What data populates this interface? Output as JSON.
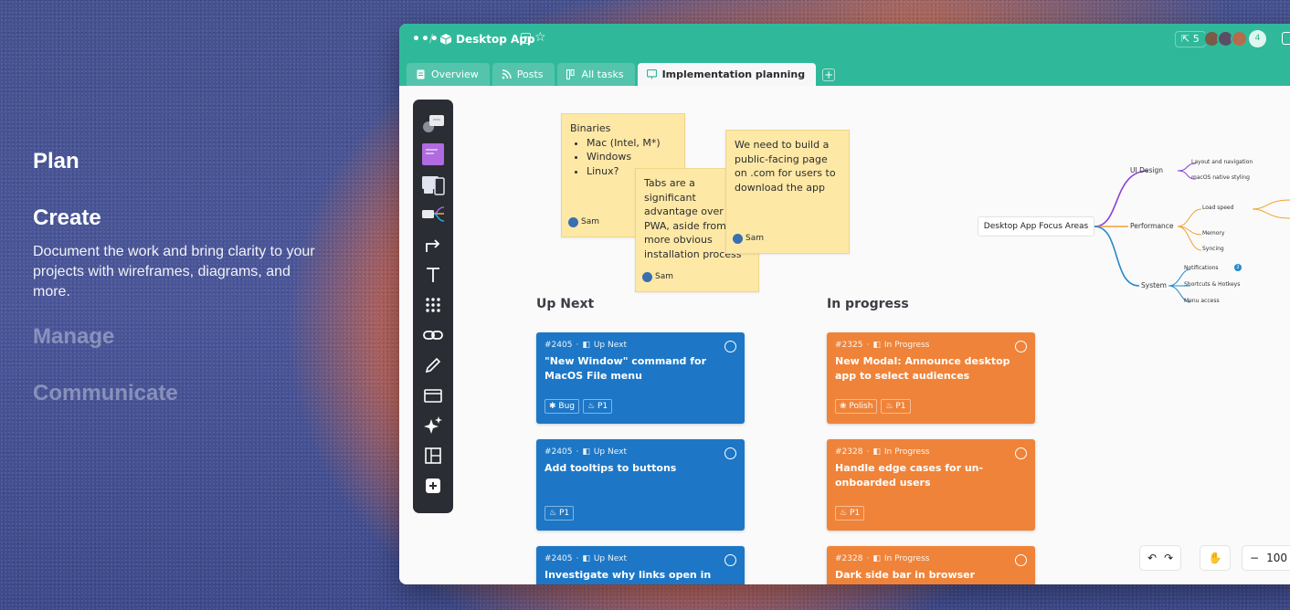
{
  "promo": {
    "plan": "Plan",
    "create": "Create",
    "description": "Document the work and bring clarity to your projects with wireframes, diagrams, and more.",
    "manage": "Manage",
    "communicate": "Communicate"
  },
  "titlebar": {
    "more": "•••",
    "app_title": "Desktop App",
    "share_count": "5",
    "extra_members": "4"
  },
  "tabs": [
    {
      "label": "Overview"
    },
    {
      "label": "Posts"
    },
    {
      "label": "All tasks"
    },
    {
      "label": "Implementation planning"
    }
  ],
  "stickies": {
    "binaries": {
      "title": "Binaries",
      "items": [
        "Mac (Intel, M*)",
        "Windows",
        "Linux?"
      ],
      "author": "Sam"
    },
    "tabs_note": {
      "text": "Tabs are a significant advantage over the PWA, aside from a more obvious installation process",
      "author": "Sam"
    },
    "public_page": {
      "text": "We need to build a public-facing page on .com for users to download the app",
      "author": "Sam"
    }
  },
  "columns": {
    "up_next": "Up Next",
    "in_progress": "In progress"
  },
  "cards": {
    "up_next": [
      {
        "id": "#2405",
        "status": "Up Next",
        "title": "\"New Window\" command for MacOS File menu",
        "tags": [
          "Bug",
          "P1"
        ]
      },
      {
        "id": "#2405",
        "status": "Up Next",
        "title": "Add tooltips to buttons",
        "tags": [
          "P1"
        ]
      },
      {
        "id": "#2405",
        "status": "Up Next",
        "title": "Investigate why links open in browser",
        "tags": []
      }
    ],
    "in_progress": [
      {
        "id": "#2325",
        "status": "In Progress",
        "title": "New Modal: Announce desktop app to select audiences",
        "tags": [
          "Polish",
          "P1"
        ]
      },
      {
        "id": "#2328",
        "status": "In Progress",
        "title": "Handle edge cases for un-onboarded users",
        "tags": [
          "P1"
        ]
      },
      {
        "id": "#2328",
        "status": "In Progress",
        "title": "Dark side bar in browser",
        "tags": []
      }
    ]
  },
  "mindmap": {
    "root": "Desktop App Focus Areas",
    "ui_design": "UI Design",
    "layout_nav": "Layout and navigation",
    "macos_styling": "macOS native styling",
    "performance": "Performance",
    "load_speed": "Load speed",
    "memory": "Memory",
    "syncing": "Syncing",
    "system": "System",
    "notifications": "Notifications",
    "notif_count": "2",
    "shortcuts": "Shortcuts & Hotkeys",
    "menu_access": "Menu access"
  },
  "controls": {
    "zoom": "100"
  },
  "colors": {
    "accent": "#2fb99a",
    "card_blue": "#1d77c6",
    "card_orange": "#ef8339",
    "sticky": "#fde8a6"
  }
}
